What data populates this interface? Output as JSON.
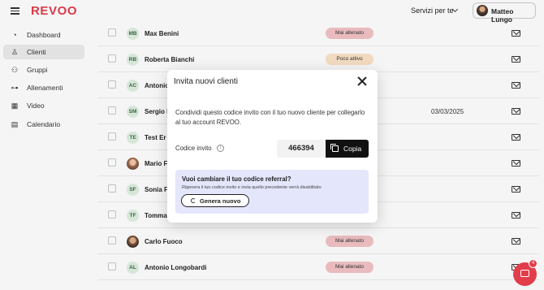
{
  "app": {
    "logo": "REVOO",
    "services_label": "Servizi per te",
    "user_name": "Matteo Lungo",
    "brand_color": "#e23d4b"
  },
  "sidebar": {
    "items": [
      {
        "label": "Dashboard",
        "icon": "gauge-icon"
      },
      {
        "label": "Clienti",
        "icon": "user-icon",
        "active": true
      },
      {
        "label": "Gruppi",
        "icon": "group-icon"
      },
      {
        "label": "Allenamenti",
        "icon": "dumbbell-icon"
      },
      {
        "label": "Video",
        "icon": "film-icon"
      },
      {
        "label": "Calendario",
        "icon": "calendar-icon"
      }
    ]
  },
  "clients": [
    {
      "initials": "MB",
      "name": "Max Benini",
      "status": "Mai allenato",
      "date": ""
    },
    {
      "initials": "RB",
      "name": "Roberta Bianchi",
      "status": "Poco attivo",
      "date": ""
    },
    {
      "initials": "AC",
      "name": "Antonio",
      "status": "",
      "date": ""
    },
    {
      "initials": "SM",
      "name": "Sergio F",
      "status": "",
      "date": "03/03/2025"
    },
    {
      "initials": "TE",
      "name": "Test Er",
      "status": "",
      "date": ""
    },
    {
      "initials": "",
      "name": "Mario F",
      "status": "",
      "date": ""
    },
    {
      "initials": "SF",
      "name": "Sonia F",
      "status": "",
      "date": ""
    },
    {
      "initials": "TF",
      "name": "Tomma",
      "status": "",
      "date": ""
    },
    {
      "initials": "",
      "name": "Carlo Fuoco",
      "status": "Mai allenato",
      "date": ""
    },
    {
      "initials": "AL",
      "name": "Antonio Longobardi",
      "status": "Mai allenato",
      "date": ""
    }
  ],
  "modal": {
    "title": "Invita nuovi clienti",
    "description": "Condividi questo codice invito con il tuo nuovo cliente per collegarlo al tuo account REVOO.",
    "code_label": "Codice invito",
    "code": "466394",
    "copy_label": "Copia",
    "referral": {
      "title": "Vuoi cambiare il tuo codice referral?",
      "subtitle": "Rigenera il tuo codice invito e invia quello precedente verrà disabilitato",
      "button_label": "Genera nuovo"
    }
  },
  "chat": {
    "badge": "4"
  }
}
